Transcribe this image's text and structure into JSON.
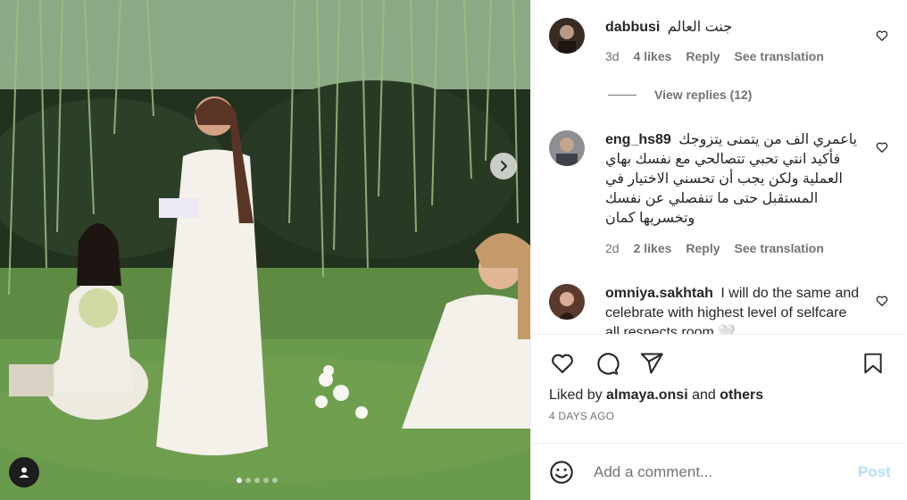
{
  "photo": {
    "carousel_dots_total": 5,
    "carousel_active_index": 0
  },
  "comments": [
    {
      "username": "dabbusi",
      "text": "جنت العالم",
      "age": "3d",
      "likes": "4 likes",
      "reply": "Reply",
      "translate": "See translation",
      "view_replies": "View replies (12)"
    },
    {
      "username": "eng_hs89",
      "text": "ياعمري الف من يتمنى يتزوجك فأكيد انتي تحبي تتصالحي مع نفسك بهاي العملية ولكن يجب أن تحسني الاختيار في المستقبل حتى ما تنفصلي عن نفسك وتخسريها كمان",
      "age": "2d",
      "likes": "2 likes",
      "reply": "Reply",
      "translate": "See translation"
    },
    {
      "username": "omniya.sakhtah",
      "text": "I will do the same and celebrate with highest level of selfcare all respects room 🤍"
    }
  ],
  "post": {
    "liked_by_prefix": "Liked by",
    "liked_by_user": "almaya.onsi",
    "liked_by_and": "and",
    "liked_by_others": "others",
    "age": "4 DAYS AGO"
  },
  "add_comment": {
    "placeholder": "Add a comment...",
    "post_label": "Post"
  },
  "colors": {
    "text": "#262626",
    "secondary": "#737373",
    "post_disabled": "#b2dffc",
    "divider": "#efefef"
  },
  "icons": [
    "chevron-right-icon",
    "user-tag-icon",
    "heart-icon",
    "comment-icon",
    "share-icon",
    "bookmark-icon",
    "emoji-icon"
  ]
}
